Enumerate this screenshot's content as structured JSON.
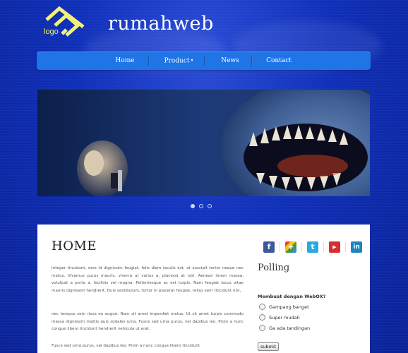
{
  "header": {
    "logo_text": "logo",
    "site_title": "rumahweb"
  },
  "nav": {
    "items": [
      {
        "label": "Home"
      },
      {
        "label": "Product"
      },
      {
        "label": "News"
      },
      {
        "label": "Contact"
      }
    ]
  },
  "slider": {
    "image": "shark-and-diver-photo",
    "pagination_count": 3,
    "active_index": 0
  },
  "main": {
    "title": "HOME",
    "paragraphs": [
      "Integer tincidunt, eros id dignissim feugiat, felis diam iaculis est, at suscipit tortor neque nec metus. Vivamus purus mauris, viverra ut varius a, placerat at nisl. Aenean lorem massa, volutpat a porta a, facilisis vel magna. Pellentesque ac est turpis. Nam feugiat lacus vitae mauris dignissim hendrerit. Duis vestibulum, tortor in placerat feugiat, tellus sem tincidunt nisl,",
      "nec tempus sem risus eu augue. Nam sit amet imperdiet metus. Ut sit amet turpis commodo massa dignissim mattis quis sodales urna. Fusce sed urna purus, vel dapibus leo. Proin a nunc congue libero tincidunt hendrerit vehicula ut erat.",
      "Fusce sed urna purus, vel dapibus leo. Proin a nunc congue libero tincidunt"
    ]
  },
  "sidebar": {
    "social_icons": [
      "facebook-icon",
      "google-plus-icon",
      "twitter-icon",
      "youtube-icon",
      "linkedin-icon"
    ],
    "poll": {
      "title": "Polling",
      "question": "Membuat dengan WebOX?",
      "options": [
        "Gampang banget",
        "Super mudah",
        "Ga ada tandingan"
      ],
      "submit_label": "submit"
    }
  },
  "colors": {
    "background": "#0f2fb8",
    "nav": "#1f74e6",
    "logo": "#f1f07a",
    "facebook": "#3b5998",
    "twitter": "#2aa9e0",
    "youtube": "#d62f2f",
    "linkedin": "#1b86bc"
  }
}
